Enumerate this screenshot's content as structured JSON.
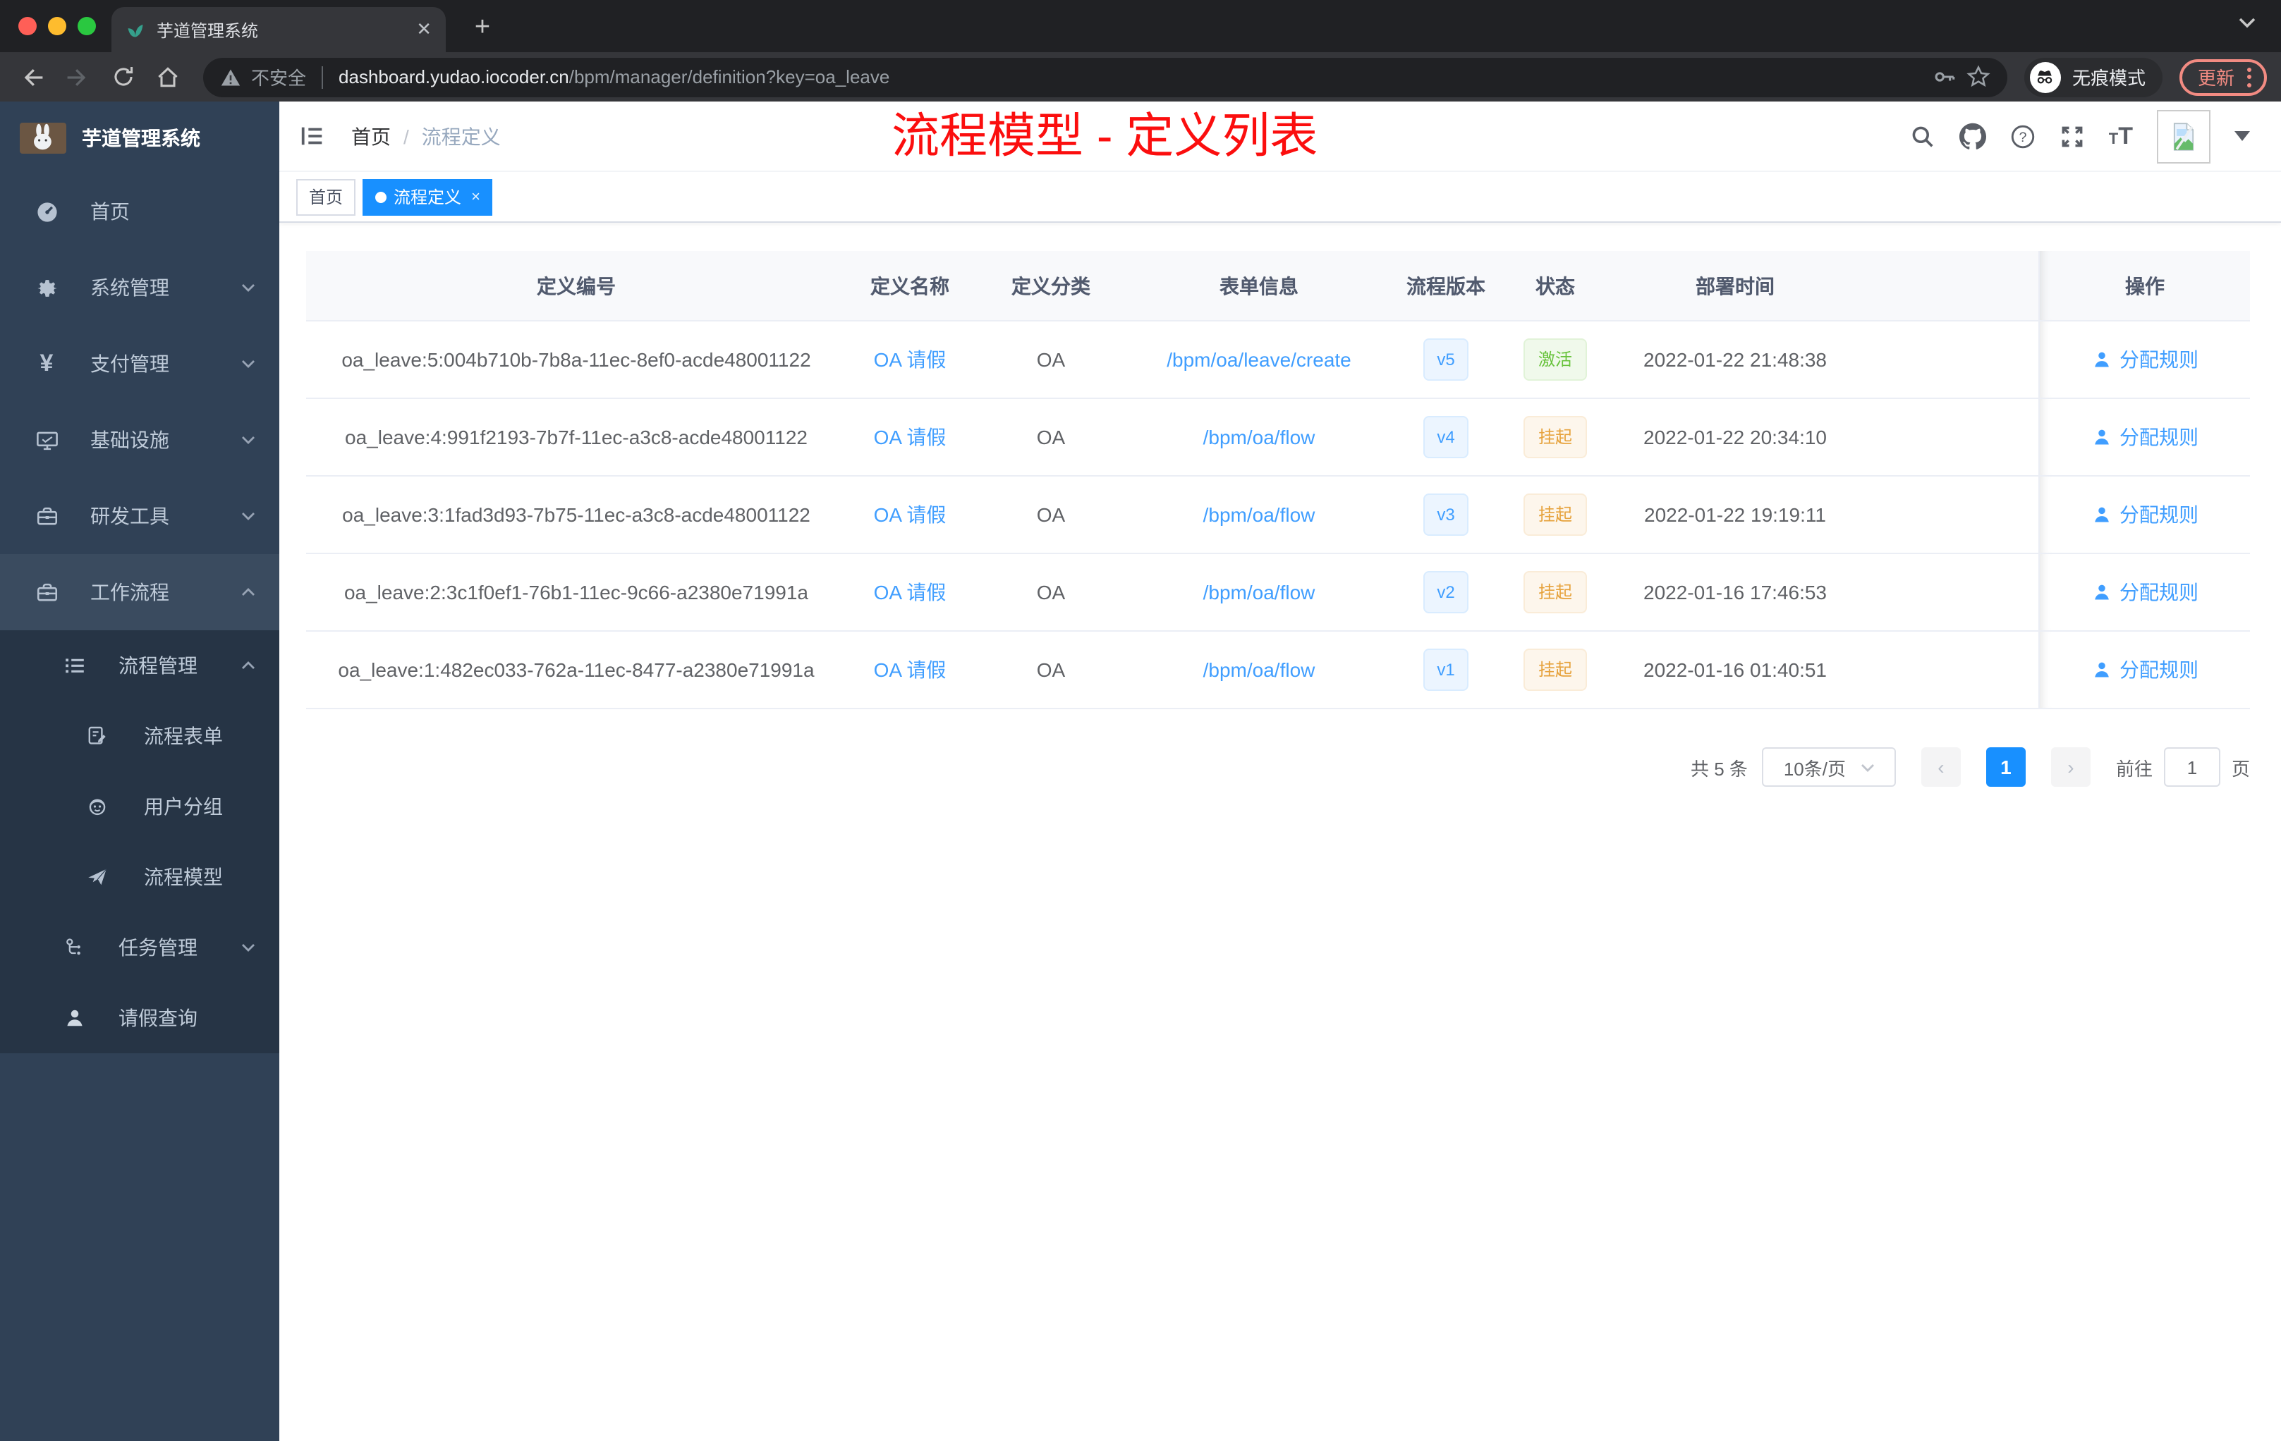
{
  "browser": {
    "tab_title": "芋道管理系统",
    "security_label": "不安全",
    "url_host": "dashboard.yudao.iocoder.cn",
    "url_path": "/bpm/manager/definition?key=oa_leave",
    "incognito_label": "无痕模式",
    "update_label": "更新",
    "new_tab_glyph": "+"
  },
  "sidebar": {
    "title": "芋道管理系统",
    "items": {
      "home": {
        "label": "首页"
      },
      "system": {
        "label": "系统管理"
      },
      "payment": {
        "label": "支付管理"
      },
      "infra": {
        "label": "基础设施"
      },
      "devtools": {
        "label": "研发工具"
      },
      "workflow": {
        "label": "工作流程"
      },
      "process_mgmt": {
        "label": "流程管理"
      },
      "process_form": {
        "label": "流程表单"
      },
      "user_group": {
        "label": "用户分组"
      },
      "process_model": {
        "label": "流程模型"
      },
      "task_mgmt": {
        "label": "任务管理"
      },
      "leave_query": {
        "label": "请假查询"
      }
    }
  },
  "header": {
    "breadcrumb_home": "首页",
    "breadcrumb_separator": "/",
    "breadcrumb_current": "流程定义",
    "annotation": "流程模型 - 定义列表"
  },
  "tags": {
    "home": "首页",
    "active": "流程定义",
    "close_glyph": "×"
  },
  "table": {
    "headers": [
      "定义编号",
      "定义名称",
      "定义分类",
      "表单信息",
      "流程版本",
      "状态",
      "部署时间",
      "操作"
    ],
    "rows": [
      {
        "id": "oa_leave:5:004b710b-7b8a-11ec-8ef0-acde48001122",
        "name": "OA 请假",
        "category": "OA",
        "form": "/bpm/oa/leave/create",
        "version": "v5",
        "status": "激活",
        "status_type": "green",
        "deploy_time": "2022-01-22 21:48:38",
        "action": "分配规则"
      },
      {
        "id": "oa_leave:4:991f2193-7b7f-11ec-a3c8-acde48001122",
        "name": "OA 请假",
        "category": "OA",
        "form": "/bpm/oa/flow",
        "version": "v4",
        "status": "挂起",
        "status_type": "yellow",
        "deploy_time": "2022-01-22 20:34:10",
        "action": "分配规则"
      },
      {
        "id": "oa_leave:3:1fad3d93-7b75-11ec-a3c8-acde48001122",
        "name": "OA 请假",
        "category": "OA",
        "form": "/bpm/oa/flow",
        "version": "v3",
        "status": "挂起",
        "status_type": "yellow",
        "deploy_time": "2022-01-22 19:19:11",
        "action": "分配规则"
      },
      {
        "id": "oa_leave:2:3c1f0ef1-76b1-11ec-9c66-a2380e71991a",
        "name": "OA 请假",
        "category": "OA",
        "form": "/bpm/oa/flow",
        "version": "v2",
        "status": "挂起",
        "status_type": "yellow",
        "deploy_time": "2022-01-16 17:46:53",
        "action": "分配规则"
      },
      {
        "id": "oa_leave:1:482ec033-762a-11ec-8477-a2380e71991a",
        "name": "OA 请假",
        "category": "OA",
        "form": "/bpm/oa/flow",
        "version": "v1",
        "status": "挂起",
        "status_type": "yellow",
        "deploy_time": "2022-01-16 01:40:51",
        "action": "分配规则"
      }
    ]
  },
  "pagination": {
    "total_label": "共 5 条",
    "page_size_label": "10条/页",
    "prev_glyph": "‹",
    "next_glyph": "›",
    "current_page": "1",
    "goto_label": "前往",
    "goto_value": "1",
    "page_unit": "页"
  },
  "colors": {
    "accent_link": "#409eff",
    "accent_strong": "#1890ff",
    "success_green": "#67c23a",
    "warning_yellow": "#e6a23c",
    "annotation_red": "#fb0e0e",
    "sidebar_bg": "#304156",
    "submenu_bg": "#263445",
    "chrome_dark": "#202124",
    "toolbar_dark": "#35363a"
  }
}
